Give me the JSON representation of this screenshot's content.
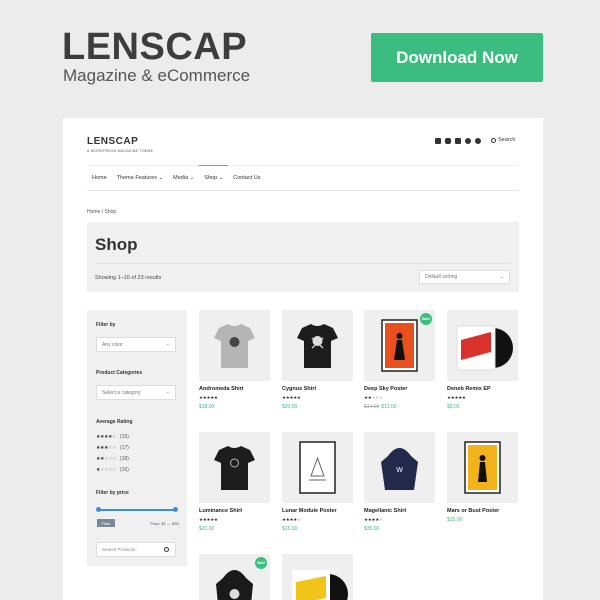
{
  "promo": {
    "title": "LENSCAP",
    "subtitle": "Magazine & eCommerce",
    "download_label": "Download Now"
  },
  "site": {
    "logo_name": "LENSCAP",
    "logo_tag": "A WORDPRESS MAGAZINE THEME",
    "search_label": "Search",
    "nav": [
      "Home",
      "Theme Features ⌄",
      "Media ⌄",
      "Shop ⌄",
      "Contact Us"
    ],
    "breadcrumb": "Home / Shop",
    "shop_title": "Shop",
    "showing": "Showing 1–10 of 23 results",
    "sorting": "Default sorting",
    "sidebar": {
      "filter_by": "Filter by",
      "any_color": "Any color",
      "categories_label": "Product Categories",
      "select_category": "Select a category",
      "rating_label": "Average Rating",
      "ratings": [
        {
          "stars": 4,
          "count": "(15)"
        },
        {
          "stars": 3,
          "count": "(17)"
        },
        {
          "stars": 2,
          "count": "(18)"
        },
        {
          "stars": 1,
          "count": "(16)"
        }
      ],
      "price_label": "Filter by price",
      "filter_button": "Filter",
      "price_range": "Price: $2 — $35",
      "search_placeholder": "Search Products..."
    },
    "products": [
      {
        "name": "Andromeda Shirt",
        "rating": 5,
        "price": "$18.00",
        "old_price": "",
        "sale": false,
        "kind": "tshirt-grey"
      },
      {
        "name": "Cygnus Shirt",
        "rating": 4.5,
        "price": "$20.00",
        "old_price": "",
        "sale": false,
        "kind": "tshirt-black-skull"
      },
      {
        "name": "Deep Sky Poster",
        "rating": 2,
        "price": "$12.00",
        "old_price": "$14.00",
        "sale": true,
        "kind": "poster-orange"
      },
      {
        "name": "Deneb Remix EP",
        "rating": 5,
        "price": "$9.00",
        "old_price": "",
        "sale": false,
        "kind": "vinyl-red"
      },
      {
        "name": "Luminance Shirt",
        "rating": 5,
        "price": "$20.00",
        "old_price": "",
        "sale": false,
        "kind": "tshirt-black"
      },
      {
        "name": "Lunar Module Poster",
        "rating": 4,
        "price": "$15.00",
        "old_price": "",
        "sale": false,
        "kind": "poster-white"
      },
      {
        "name": "Magellanic Shirt",
        "rating": 4,
        "price": "$35.00",
        "old_price": "",
        "sale": false,
        "kind": "hoodie-navy"
      },
      {
        "name": "Mars or Bust Poster",
        "rating": 0,
        "price": "$15.00",
        "old_price": "",
        "sale": false,
        "kind": "poster-yellow"
      },
      {
        "name": "",
        "rating": 0,
        "price": "",
        "old_price": "",
        "sale": true,
        "kind": "hoodie-black"
      },
      {
        "name": "",
        "rating": 0,
        "price": "",
        "old_price": "",
        "sale": false,
        "kind": "vinyl-yellow"
      }
    ],
    "sale_label": "Sale!"
  },
  "colors": {
    "accent": "#3bbd7f",
    "slider": "#3b8fd6"
  }
}
